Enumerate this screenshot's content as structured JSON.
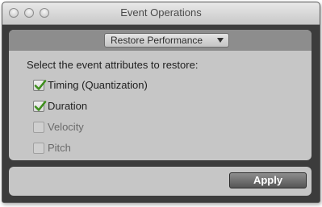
{
  "window": {
    "title": "Event Operations"
  },
  "operation_menu": {
    "selected": "Restore Performance"
  },
  "prompt": "Select the event attributes to restore:",
  "attributes": [
    {
      "label": "Timing (Quantization)",
      "checked": true
    },
    {
      "label": "Duration",
      "checked": true
    },
    {
      "label": "Velocity",
      "checked": false
    },
    {
      "label": "Pitch",
      "checked": false
    }
  ],
  "apply_button": {
    "label": "Apply"
  }
}
